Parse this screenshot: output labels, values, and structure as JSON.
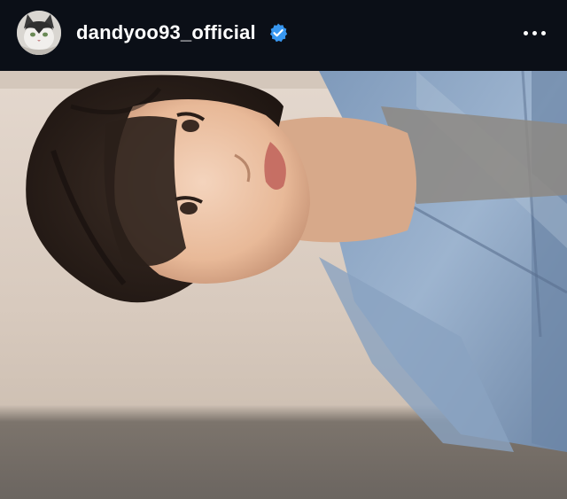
{
  "post_header": {
    "username": "dandyoo93_official",
    "verified": true,
    "verified_color": "#3897f0",
    "avatar_icon": "cat-avatar",
    "more_icon": "more-options-icon"
  },
  "post_image": {
    "subject_icon": "portrait-photo",
    "background_color": "#d9cdc3",
    "jacket_color": "#8fa7c2"
  }
}
